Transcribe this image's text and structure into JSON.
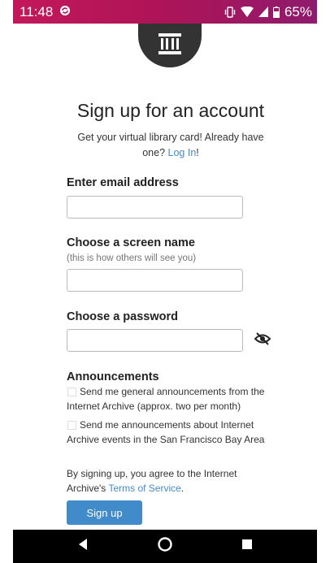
{
  "status_bar": {
    "time": "11:48",
    "battery_percent": "65%",
    "icons": [
      "sync-icon",
      "vibrate-icon",
      "wifi-icon",
      "cell-signal-icon",
      "battery-icon"
    ]
  },
  "logo": {
    "icon": "archive-building-icon"
  },
  "header": {
    "title": "Sign up for an account",
    "subtitle_prefix": "Get your virtual library card! Already have one?",
    "login_link": "Log In",
    "subtitle_suffix": "!"
  },
  "form": {
    "email": {
      "label": "Enter email address",
      "value": "",
      "placeholder": ""
    },
    "screen_name": {
      "label": "Choose a screen name",
      "hint": "(this is how others will see you)",
      "value": "",
      "placeholder": ""
    },
    "password": {
      "label": "Choose a password",
      "value": "",
      "placeholder": "",
      "toggle_icon": "eye-slash-icon"
    }
  },
  "announcements": {
    "heading": "Announcements",
    "options": [
      {
        "label": "Send me general announcements from the Internet Archive (approx. two per month)",
        "checked": false
      },
      {
        "label": "Send me announcements about Internet Archive events in the San Francisco Bay Area",
        "checked": false
      }
    ]
  },
  "terms": {
    "prefix": "By signing up, you agree to the Internet Archive's",
    "link": "Terms of Service",
    "suffix": "."
  },
  "submit": {
    "label": "Sign up"
  },
  "nav_bar": {
    "icons": [
      "back-icon",
      "home-icon",
      "recents-icon"
    ]
  },
  "colors": {
    "status_bar_start": "#c2185b",
    "status_bar_end": "#8e1b6e",
    "link": "#428bca",
    "button": "#428bca",
    "logo_bg": "#333333",
    "nav_bar": "#000000"
  }
}
